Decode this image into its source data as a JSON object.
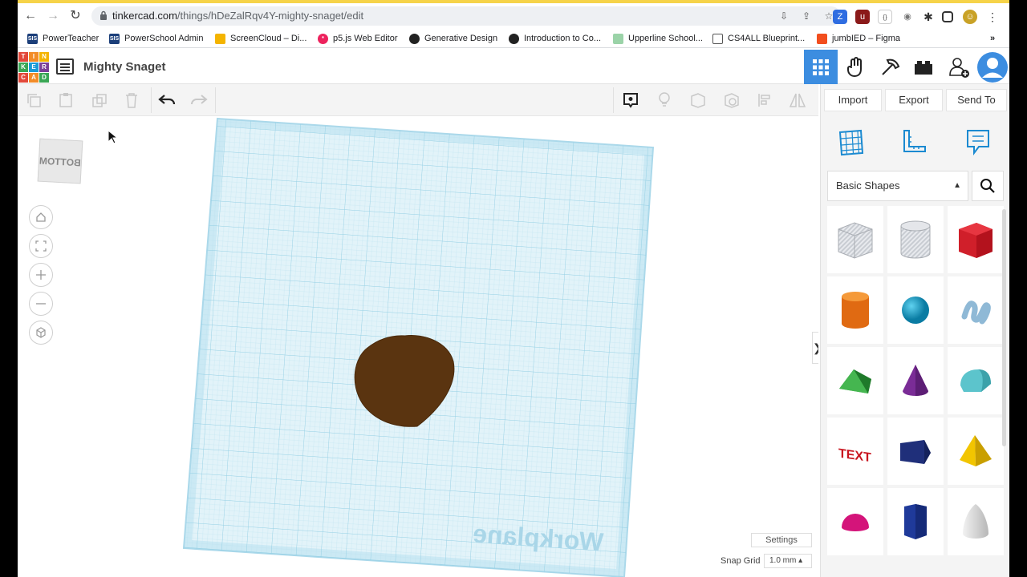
{
  "browser": {
    "url_host": "tinkercad.com",
    "url_path": "/things/hDeZalRqv4Y-mighty-snaget/edit",
    "bookmarks": [
      {
        "label": "PowerTeacher",
        "icon": "sis-icon"
      },
      {
        "label": "PowerSchool Admin",
        "icon": "sis-icon"
      },
      {
        "label": "ScreenCloud – Di...",
        "icon": "screencloud-icon"
      },
      {
        "label": "p5.js Web Editor",
        "icon": "p5-icon"
      },
      {
        "label": "Generative Design",
        "icon": "globe-icon"
      },
      {
        "label": "Introduction to Co...",
        "icon": "globe-icon"
      },
      {
        "label": "Upperline School...",
        "icon": "upperline-icon"
      },
      {
        "label": "CS4ALL Blueprint...",
        "icon": "doc-icon"
      },
      {
        "label": "jumbIED – Figma",
        "icon": "figma-icon"
      }
    ],
    "more_bookmarks": "»"
  },
  "app": {
    "logo_letters": [
      "T",
      "I",
      "N",
      "K",
      "E",
      "R",
      "C",
      "A",
      "D"
    ],
    "logo_colors": [
      "#e2483a",
      "#f28c28",
      "#f4b400",
      "#3aa655",
      "#1b9bd7",
      "#7b3f98",
      "#e2483a",
      "#f28c28",
      "#3aa655"
    ],
    "design_title": "Mighty Snaget",
    "accent": "#3c8de0"
  },
  "right_panel": {
    "import_label": "Import",
    "export_label": "Export",
    "send_to_label": "Send To",
    "shape_category": "Basic Shapes",
    "shapes": [
      "Box Hole",
      "Cylinder Hole",
      "Box",
      "Cylinder",
      "Sphere",
      "Scribble",
      "Roof",
      "Cone",
      "Round Roof",
      "Text",
      "Wedge",
      "Pyramid",
      "Half Sphere",
      "Polygon",
      "Paraboloid"
    ]
  },
  "canvas": {
    "viewcube_label": "BOTTOM",
    "workplane_label": "Workplane",
    "settings_label": "Settings",
    "snap_grid_label": "Snap Grid",
    "snap_grid_value": "1.0 mm ▴",
    "panel_toggle": "❯"
  }
}
